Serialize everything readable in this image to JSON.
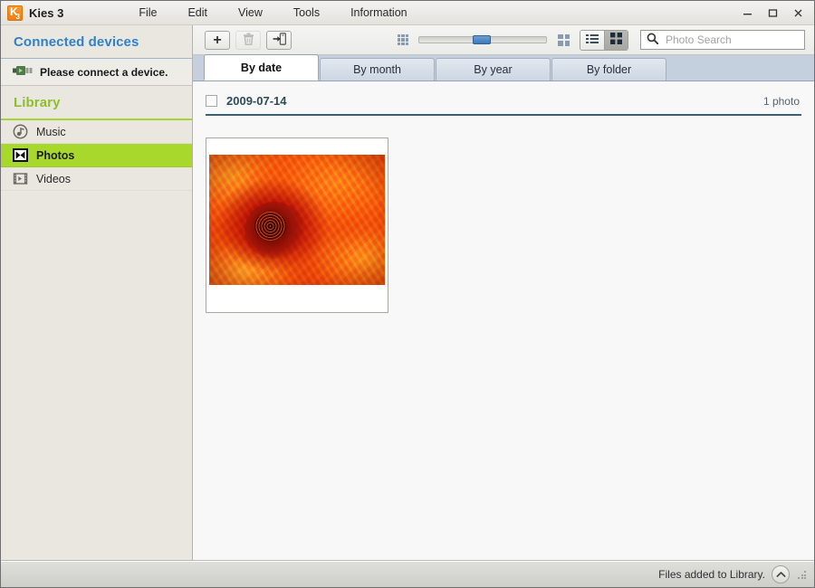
{
  "window": {
    "title": "Kies 3",
    "icon": "kies-app-icon",
    "icon_letter": "K",
    "icon_sub": "3",
    "controls": {
      "minimize": "minimize-icon",
      "maximize": "maximize-icon",
      "close": "close-icon"
    }
  },
  "menubar": {
    "items": [
      {
        "label": "File"
      },
      {
        "label": "Edit"
      },
      {
        "label": "View"
      },
      {
        "label": "Tools"
      },
      {
        "label": "Information"
      }
    ]
  },
  "sidebar": {
    "connected_devices": {
      "header": "Connected devices",
      "header_color": "#2f82c8",
      "empty_message": "Please connect a device.",
      "device_icon": "usb-connector-icon"
    },
    "library": {
      "header": "Library",
      "header_color": "#8cbf2a",
      "items": [
        {
          "label": "Music",
          "icon": "music-note-icon",
          "active": false
        },
        {
          "label": "Photos",
          "icon": "photo-icon",
          "active": true
        },
        {
          "label": "Videos",
          "icon": "film-strip-icon",
          "active": false
        }
      ],
      "active_color": "#a8d82c"
    }
  },
  "toolbar": {
    "add_label": "+",
    "add_icon": "plus-icon",
    "delete_icon": "trash-icon",
    "export_icon": "export-to-device-icon",
    "thumb_small_icon": "small-grid-icon",
    "thumb_large_icon": "large-grid-icon",
    "zoom_slider": {
      "value": 48,
      "min": 0,
      "max": 100
    },
    "view_list_icon": "list-view-icon",
    "view_grid_icon": "grid-view-icon",
    "active_view": "grid"
  },
  "search": {
    "placeholder": "Photo Search",
    "value": "",
    "icon": "search-icon"
  },
  "tabs": [
    {
      "label": "By date",
      "active": true
    },
    {
      "label": "By month",
      "active": false
    },
    {
      "label": "By year",
      "active": false
    },
    {
      "label": "By folder",
      "active": false
    }
  ],
  "content": {
    "group": {
      "date": "2009-07-14",
      "count_label": "1 photo",
      "checked": false,
      "rule_color": "#3f6070"
    },
    "photos": [
      {
        "alt": "red-orange chrysanthemum flower close-up"
      }
    ]
  },
  "statusbar": {
    "message": "Files added to Library.",
    "chevron_icon": "chevron-up-icon",
    "grip_icon": "resize-grip-icon"
  }
}
